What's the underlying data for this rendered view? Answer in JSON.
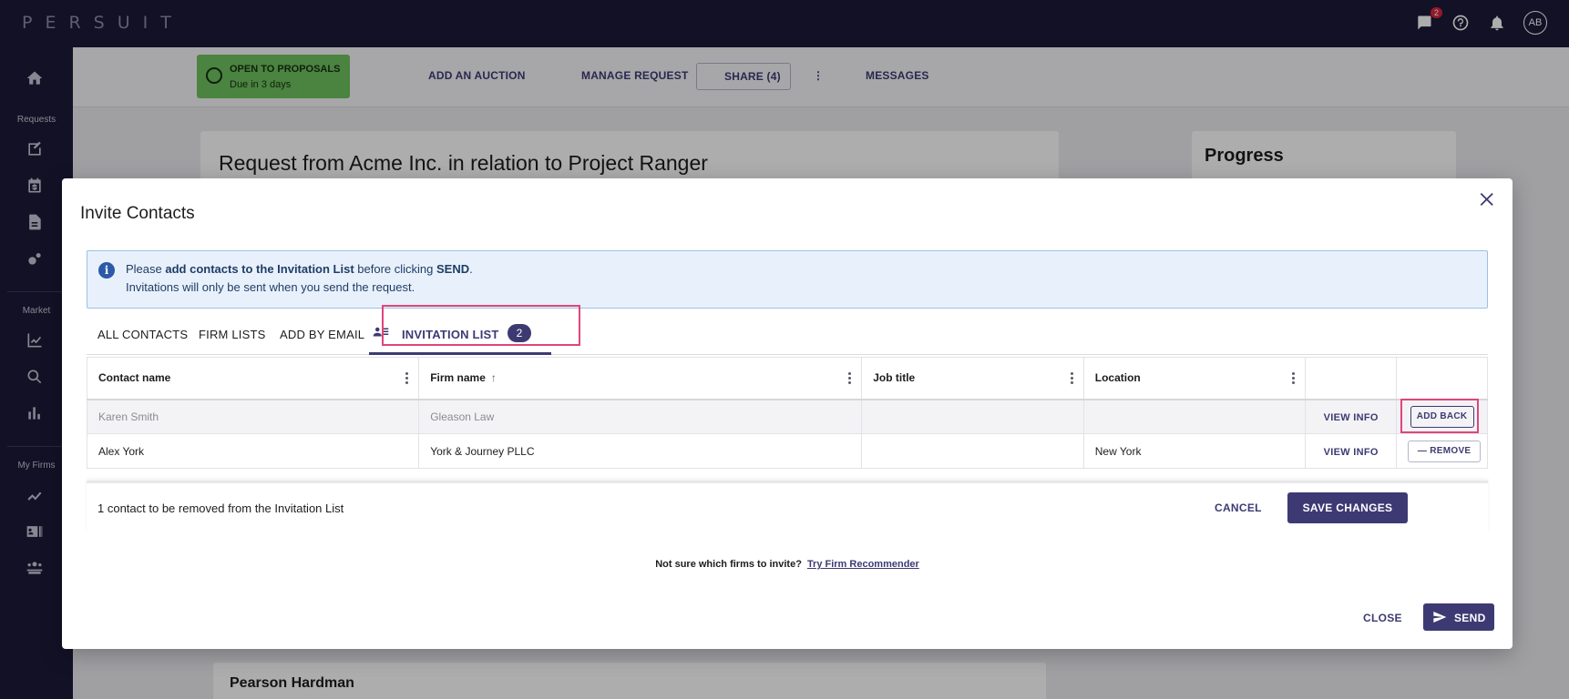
{
  "app": {
    "logo": "PERSUIT",
    "user_initials": "AB",
    "notification_count": "2"
  },
  "sidebar": {
    "sections": {
      "requests": "Requests",
      "market": "Market",
      "my_firms": "My Firms"
    }
  },
  "request_header": {
    "status_title": "OPEN TO PROPOSALS",
    "status_due": "Due in 3 days",
    "add_auction": "ADD AN AUCTION",
    "manage_request": "MANAGE REQUEST",
    "share": "SHARE (4)",
    "messages": "MESSAGES"
  },
  "background": {
    "request_title": "Request from Acme Inc. in relation to Project Ranger",
    "progress_title": "Progress",
    "firm_card_title": "Pearson Hardman"
  },
  "modal": {
    "title": "Invite Contacts",
    "info": {
      "l1_pre": "Please ",
      "l1_bold": "add contacts to the Invitation List",
      "l1_mid": " before clicking ",
      "l1_bold2": "SEND",
      "l1_end": ".",
      "line2": "Invitations will only be sent when you send the request."
    },
    "tabs": {
      "all_contacts": "ALL CONTACTS",
      "firm_lists": "FIRM LISTS",
      "add_by_email": "ADD BY EMAIL",
      "invitation_list": "INVITATION LIST",
      "invitation_count": "2"
    },
    "table": {
      "columns": [
        "Contact name",
        "Firm name",
        "Job title",
        "Location"
      ],
      "rows": [
        {
          "name": "Karen Smith",
          "firm": "Gleason Law",
          "job": "",
          "location": "",
          "view": "VIEW INFO",
          "action": "ADD BACK",
          "state": "removed"
        },
        {
          "name": "Alex York",
          "firm": "York & Journey PLLC",
          "job": "",
          "location": "New York",
          "view": "VIEW INFO",
          "action": "REMOVE",
          "state": "active"
        }
      ]
    },
    "footer": {
      "message": "1 contact to be removed from the Invitation List",
      "cancel": "CANCEL",
      "save": "SAVE CHANGES"
    },
    "recommender": {
      "question": "Not sure which firms to invite?",
      "link": "Try Firm Recommender"
    },
    "close": "CLOSE",
    "send": "SEND"
  },
  "colors": {
    "brand": "#3d3a73",
    "nav_bg": "#1c1a38",
    "status_green": "#6fc15f",
    "highlight": "#e0457b"
  }
}
